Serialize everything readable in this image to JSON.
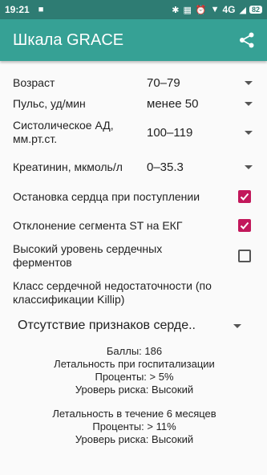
{
  "status_bar": {
    "time": "19:21",
    "network": "4G",
    "battery": "82"
  },
  "app_bar": {
    "title": "Шкала GRACE",
    "share_icon": "share-icon"
  },
  "fields": {
    "age": {
      "label": "Возраст",
      "value": "70–79"
    },
    "pulse": {
      "label": "Пульс, уд/мин",
      "value": "менее 50"
    },
    "sbp": {
      "label": "Систолическое АД, мм.рт.ст.",
      "value": "100–119"
    },
    "creatinine": {
      "label": "Креатинин, мкмоль/л",
      "value": "0–35.3"
    }
  },
  "checkboxes": {
    "cardiac_arrest": {
      "label": "Остановка сердца при поступлении",
      "checked": true
    },
    "st_deviation": {
      "label": "Отклонение сегмента ST на ЕКГ",
      "checked": true
    },
    "enzymes": {
      "label": "Высокий уровень сердечных ферментов",
      "checked": false
    }
  },
  "killip": {
    "label": "Класс сердечной недостаточности (по классификации Killip)",
    "value": "Отсутствие признаков серде.."
  },
  "results": {
    "score": "Баллы: 186",
    "hospital_title": "Летальность при госпитализации",
    "hospital_percent": "Проценты:  > 5%",
    "hospital_risk": "Уроверь риска: Высокий",
    "six_month_title": "Летальность в течение 6 месяцев",
    "six_month_percent": "Проценты:  > 11%",
    "six_month_risk": "Уроверь риска: Высокий"
  },
  "colors": {
    "status_bar": "#2e7c73",
    "app_bar": "#36a195",
    "checkbox_accent": "#c2185b"
  }
}
